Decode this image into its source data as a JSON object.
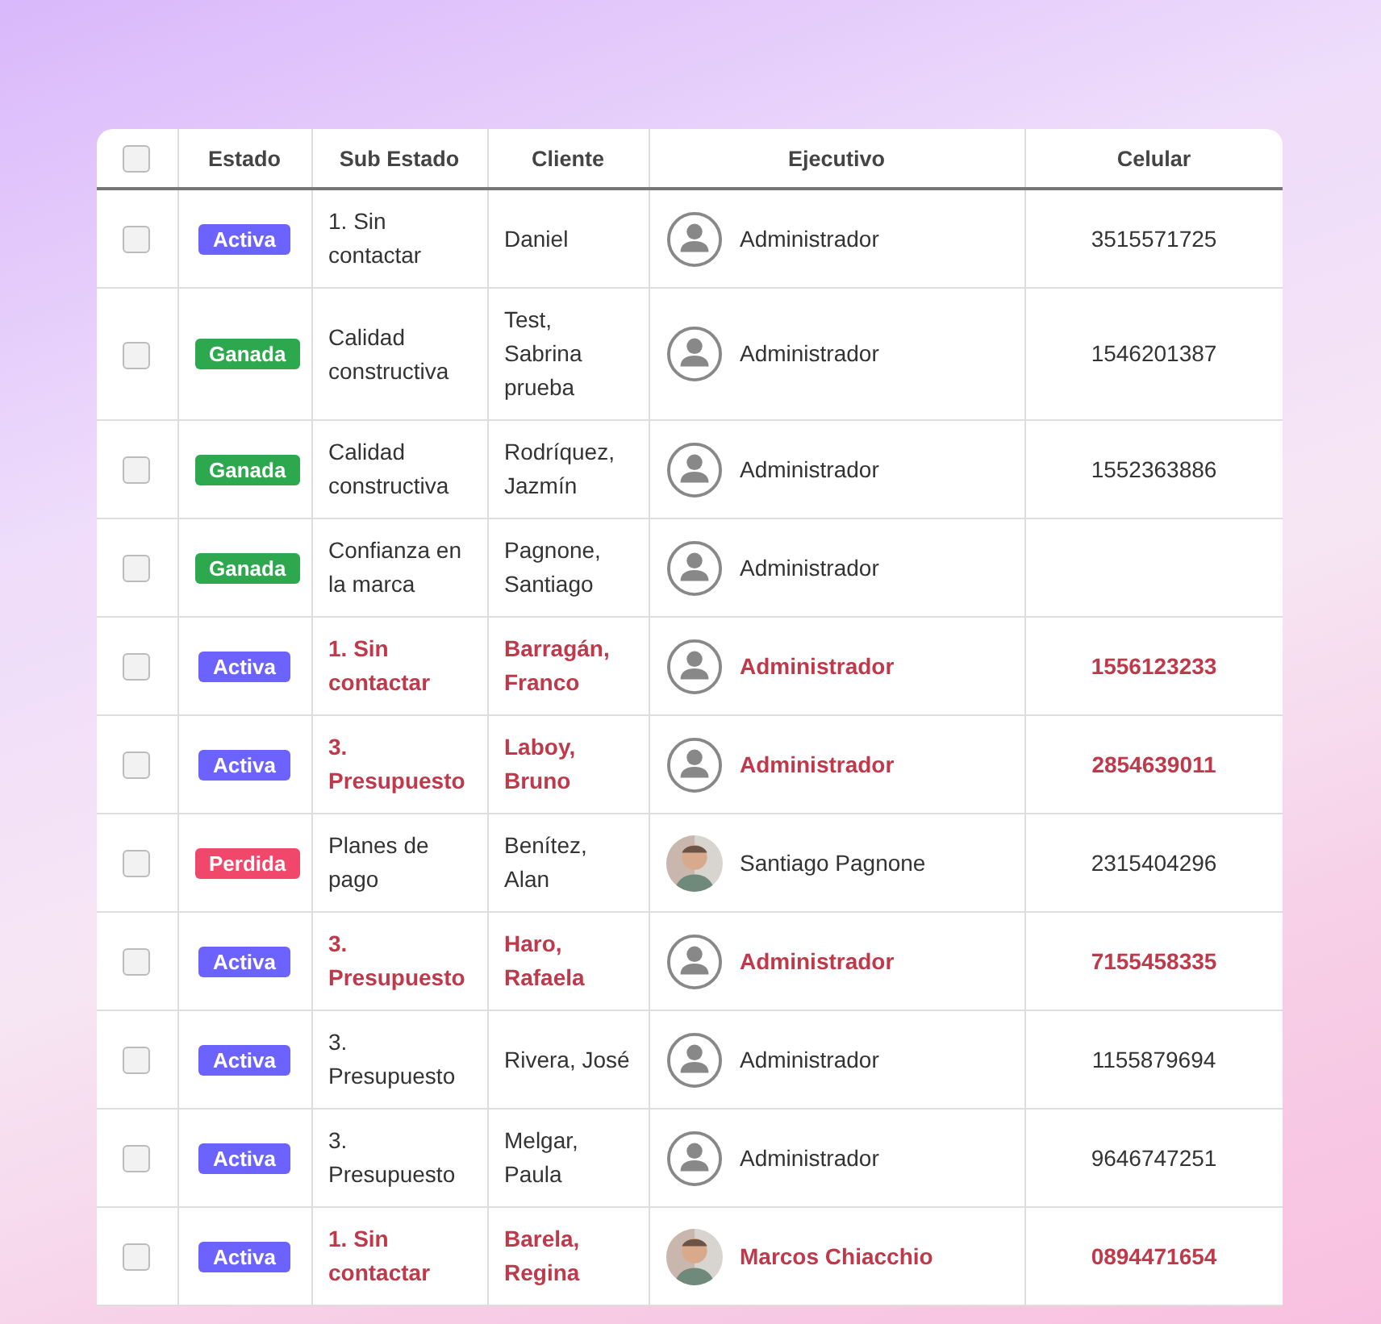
{
  "table": {
    "select_all": {
      "checked": false
    },
    "columns": [
      "Estado",
      "Sub Estado",
      "Cliente",
      "Ejecutivo",
      "Celular"
    ],
    "rows": [
      {
        "checked": false,
        "highlighted": false,
        "estado": {
          "label": "Activa",
          "color": "#6c63ff"
        },
        "sub_estado": "1. Sin contactar",
        "cliente": "Daniel",
        "avatar": {
          "kind": "icon"
        },
        "ejecutivo": "Administrador",
        "celular": "3515571725"
      },
      {
        "checked": false,
        "highlighted": false,
        "estado": {
          "label": "Ganada",
          "color": "#2ea84f"
        },
        "sub_estado": "Calidad constructiva",
        "cliente": "Test, Sabrina prueba",
        "avatar": {
          "kind": "icon"
        },
        "ejecutivo": "Administrador",
        "celular": "1546201387"
      },
      {
        "checked": false,
        "highlighted": false,
        "estado": {
          "label": "Ganada",
          "color": "#2ea84f"
        },
        "sub_estado": "Calidad constructiva",
        "cliente": "Rodríquez, Jazmín",
        "avatar": {
          "kind": "icon"
        },
        "ejecutivo": "Administrador",
        "celular": "1552363886"
      },
      {
        "checked": false,
        "highlighted": false,
        "estado": {
          "label": "Ganada",
          "color": "#2ea84f"
        },
        "sub_estado": "Confianza en la marca",
        "cliente": "Pagnone, Santiago",
        "avatar": {
          "kind": "icon"
        },
        "ejecutivo": "Administrador"
      },
      {
        "checked": false,
        "highlighted": true,
        "estado": {
          "label": "Activa",
          "color": "#6c63ff"
        },
        "sub_estado": "1. Sin contactar",
        "cliente": "Barragán, Franco",
        "avatar": {
          "kind": "icon"
        },
        "ejecutivo": "Administrador",
        "celular": "1556123233"
      },
      {
        "checked": false,
        "highlighted": true,
        "estado": {
          "label": "Activa",
          "color": "#6c63ff"
        },
        "sub_estado": "3. Presupuesto",
        "cliente": "Laboy, Bruno",
        "avatar": {
          "kind": "icon"
        },
        "ejecutivo": "Administrador",
        "celular": "2854639011"
      },
      {
        "checked": false,
        "highlighted": false,
        "estado": {
          "label": "Perdida",
          "color": "#f0476a"
        },
        "sub_estado": "Planes de pago",
        "cliente": "Benítez, Alan",
        "ejecutivo": "Santiago Pagnone",
        "celular": "2315404296"
      },
      {
        "checked": false,
        "highlighted": true,
        "estado": {
          "label": "Activa",
          "color": "#6c63ff"
        },
        "sub_estado": "3. Presupuesto",
        "cliente": "Haro, Rafaela",
        "avatar": {
          "kind": "icon"
        },
        "ejecutivo": "Administrador",
        "celular": "7155458335"
      },
      {
        "checked": false,
        "highlighted": false,
        "estado": {
          "label": "Activa",
          "color": "#6c63ff"
        },
        "sub_estado": "3. Presupuesto",
        "cliente": "Rivera, José",
        "avatar": {
          "kind": "icon"
        },
        "ejecutivo": "Administrador",
        "celular": "1155879694"
      },
      {
        "checked": false,
        "highlighted": false,
        "estado": {
          "label": "Activa",
          "color": "#6c63ff"
        },
        "sub_estado": "3. Presupuesto",
        "cliente": "Melgar, Paula",
        "avatar": {
          "kind": "icon"
        },
        "ejecutivo": "Administrador",
        "celular": "9646747251"
      },
      {
        "checked": false,
        "highlighted": true,
        "estado": {
          "label": "Activa",
          "color": "#6c63ff"
        },
        "sub_estado": "1. Sin contactar",
        "cliente": "Barela, Regina",
        "ejecutivo": "Marcos Chiacchio",
        "celular": "0894471654"
      }
    ]
  }
}
